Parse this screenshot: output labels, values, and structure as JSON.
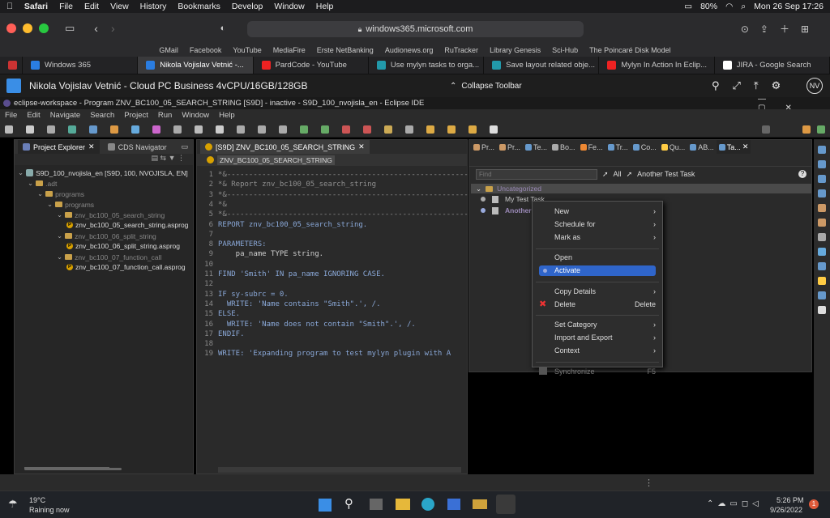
{
  "mac_menu": {
    "items": [
      "Safari",
      "File",
      "Edit",
      "View",
      "History",
      "Bookmarks",
      "Develop",
      "Window",
      "Help"
    ],
    "battery": "80%",
    "datetime": "Mon 26 Sep  17:26"
  },
  "safari": {
    "address": "windows365.microsoft.com",
    "favorites": [
      "GMail",
      "Facebook",
      "YouTube",
      "MediaFire",
      "Erste NetBanking",
      "Audionews.org",
      "RuTracker",
      "Library Genesis",
      "Sci-Hub",
      "The Poincaré Disk Model"
    ],
    "tabs": [
      {
        "label": "",
        "color": "#c33"
      },
      {
        "label": "Windows 365",
        "color": "#2a7de1"
      },
      {
        "label": "Nikola Vojislav Vetnić -...",
        "color": "#2a7de1"
      },
      {
        "label": "PardCode - YouTube",
        "color": "#e22"
      },
      {
        "label": "Use mylyn tasks to orga...",
        "color": "#29a"
      },
      {
        "label": "Save layout related obje...",
        "color": "#29a"
      },
      {
        "label": "Mylyn In Action In Eclip...",
        "color": "#e22"
      },
      {
        "label": "JIRA - Google Search",
        "color": "#fff"
      }
    ]
  },
  "w365": {
    "title": "Nikola Vojislav Vetnić - Cloud PC Business 4vCPU/16GB/128GB",
    "collapse": "Collapse Toolbar",
    "avatar": "NV"
  },
  "eclipse": {
    "title": "eclipse-workspace - Program ZNV_BC100_05_SEARCH_STRING [S9D] - inactive - S9D_100_nvojisla_en - Eclipse IDE",
    "menu": [
      "File",
      "Edit",
      "Navigate",
      "Search",
      "Project",
      "Run",
      "Window",
      "Help"
    ],
    "left_tabs": [
      "Project Explorer",
      "CDS Navigator"
    ],
    "tree": [
      {
        "label": "S9D_100_nvojisla_en [S9D, 100, NVOJISLA, EN]",
        "indent": 0,
        "type": "project",
        "dim": false
      },
      {
        "label": ".adt",
        "indent": 1,
        "type": "folder",
        "dim": true
      },
      {
        "label": "programs",
        "indent": 2,
        "type": "folder",
        "dim": true
      },
      {
        "label": "programs",
        "indent": 3,
        "type": "folder",
        "dim": true
      },
      {
        "label": "znv_bc100_05_search_string",
        "indent": 4,
        "type": "folder",
        "dim": true
      },
      {
        "label": "znv_bc100_05_search_string.asprog",
        "indent": 5,
        "type": "file",
        "dim": false
      },
      {
        "label": "znv_bc100_06_split_string",
        "indent": 4,
        "type": "folder",
        "dim": true
      },
      {
        "label": "znv_bc100_06_split_string.asprog",
        "indent": 5,
        "type": "file",
        "dim": false
      },
      {
        "label": "znv_bc100_07_function_call",
        "indent": 4,
        "type": "folder",
        "dim": true
      },
      {
        "label": "znv_bc100_07_function_call.asprog",
        "indent": 5,
        "type": "file",
        "dim": false
      }
    ],
    "editor_tab": "[S9D] ZNV_BC100_05_SEARCH_STRING",
    "editor_subtab": "ZNV_BC100_05_SEARCH_STRING",
    "code": [
      {
        "n": "1",
        "t": "*&---------------------------------------------------------------",
        "c": "comment"
      },
      {
        "n": "2",
        "t": "*& Report znv_bc100_05_search_string",
        "c": "comment"
      },
      {
        "n": "3",
        "t": "*&---------------------------------------------------------------",
        "c": "comment"
      },
      {
        "n": "4",
        "t": "*&",
        "c": "comment"
      },
      {
        "n": "5",
        "t": "*&---------------------------------------------------------------",
        "c": "comment"
      },
      {
        "n": "6",
        "t": "REPORT znv_bc100_05_search_string.",
        "c": "kw"
      },
      {
        "n": "7",
        "t": "",
        "c": "plain"
      },
      {
        "n": "8",
        "t": "PARAMETERS:",
        "c": "kw"
      },
      {
        "n": "9",
        "t": "    pa_name TYPE string.",
        "c": "plain"
      },
      {
        "n": "10",
        "t": "",
        "c": "plain"
      },
      {
        "n": "11",
        "t": "FIND 'Smith' IN pa_name IGNORING CASE.",
        "c": "kw"
      },
      {
        "n": "12",
        "t": "",
        "c": "plain"
      },
      {
        "n": "13",
        "t": "IF sy-subrc = 0.",
        "c": "kw"
      },
      {
        "n": "14",
        "t": "  WRITE: 'Name contains \"Smith\".', /.",
        "c": "kw"
      },
      {
        "n": "15",
        "t": "ELSE.",
        "c": "kw"
      },
      {
        "n": "16",
        "t": "  WRITE: 'Name does not contain \"Smith\".', /.",
        "c": "kw"
      },
      {
        "n": "17",
        "t": "ENDIF.",
        "c": "kw"
      },
      {
        "n": "18",
        "t": "",
        "c": "plain"
      },
      {
        "n": "19",
        "t": "WRITE: 'Expanding program to test mylyn plugin with A",
        "c": "kw"
      }
    ],
    "task_tabs": [
      "Pr...",
      "Pr...",
      "Te...",
      "Bo...",
      "Fe...",
      "Tr...",
      "Co...",
      "Qu...",
      "AB...",
      "Ta..."
    ],
    "task_find": "Find",
    "task_all": "All",
    "active_task": "Another Test Task",
    "task_category": "Uncategorized",
    "tasks": [
      "My Test Task",
      "Another Test Task"
    ],
    "context_menu": [
      {
        "label": "New",
        "arrow": true,
        "state": "normal"
      },
      {
        "label": "Schedule for",
        "arrow": true,
        "state": "normal"
      },
      {
        "label": "Mark as",
        "arrow": true,
        "state": "normal"
      },
      {
        "sep": true
      },
      {
        "label": "Open",
        "arrow": false,
        "state": "normal"
      },
      {
        "label": "Activate",
        "arrow": false,
        "state": "highlight"
      },
      {
        "sep": true
      },
      {
        "label": "Copy Details",
        "arrow": true,
        "state": "normal"
      },
      {
        "label": "Delete",
        "shortcut": "Delete",
        "arrow": false,
        "state": "normal",
        "icon": "delete-icon"
      },
      {
        "sep": true
      },
      {
        "label": "Set Category",
        "arrow": true,
        "state": "normal"
      },
      {
        "label": "Import and Export",
        "arrow": true,
        "state": "normal"
      },
      {
        "label": "Context",
        "arrow": true,
        "state": "normal"
      },
      {
        "sep": true
      },
      {
        "label": "Synchronize",
        "shortcut": "F5",
        "arrow": false,
        "state": "disabled",
        "icon": "sync-icon"
      }
    ]
  },
  "taskbar": {
    "weather_temp": "19°C",
    "weather_text": "Raining now",
    "time": "5:26 PM",
    "date": "9/26/2022",
    "badge": "1"
  }
}
